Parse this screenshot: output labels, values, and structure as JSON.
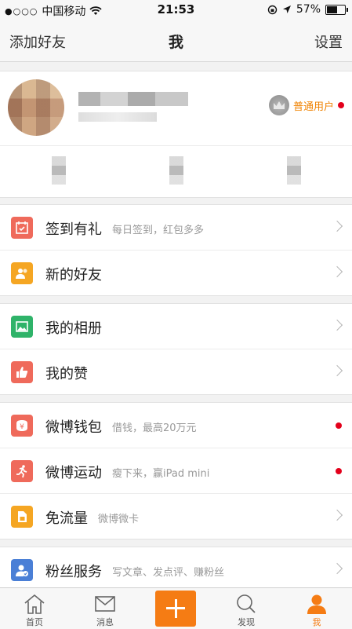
{
  "status_bar": {
    "signal": "●○○○",
    "carrier": "中国移动",
    "time": "21:53",
    "battery": "57%",
    "battery_level": 0.57
  },
  "nav": {
    "left": "添加好友",
    "title": "我",
    "right": "设置"
  },
  "profile": {
    "membership": "普通用户"
  },
  "groups": [
    [
      {
        "label": "签到有礼",
        "sub": "每日签到，红包多多",
        "icon": "calendar-icon",
        "color": "#ef6a5b",
        "end": "chevron"
      },
      {
        "label": "新的好友",
        "sub": "",
        "icon": "friends-icon",
        "color": "#f5a623",
        "end": "chevron"
      }
    ],
    [
      {
        "label": "我的相册",
        "sub": "",
        "icon": "album-icon",
        "color": "#2fb369",
        "end": "chevron"
      },
      {
        "label": "我的赞",
        "sub": "",
        "icon": "thumbs-up-icon",
        "color": "#ef6a5b",
        "end": "chevron"
      }
    ],
    [
      {
        "label": "微博钱包",
        "sub": "借钱，最高20万元",
        "icon": "wallet-icon",
        "color": "#ef6a5b",
        "end": "dot"
      },
      {
        "label": "微博运动",
        "sub": "瘦下来，赢iPad mini",
        "icon": "running-icon",
        "color": "#ef6a5b",
        "end": "dot"
      },
      {
        "label": "免流量",
        "sub": "微博微卡",
        "icon": "sim-card-icon",
        "color": "#f5a623",
        "end": "chevron"
      }
    ],
    [
      {
        "label": "粉丝服务",
        "sub": "写文章、发点评、赚粉丝",
        "icon": "fan-service-icon",
        "color": "#4a7fd6",
        "end": "chevron"
      }
    ]
  ],
  "tabs": [
    {
      "label": "首页",
      "icon": "home-icon"
    },
    {
      "label": "消息",
      "icon": "message-icon"
    },
    {
      "label": "",
      "icon": "compose-icon"
    },
    {
      "label": "发现",
      "icon": "discover-icon"
    },
    {
      "label": "我",
      "icon": "profile-icon"
    }
  ],
  "colors": {
    "accent": "#f57c14",
    "badge": "#e3001b",
    "membership": "#f08200"
  }
}
